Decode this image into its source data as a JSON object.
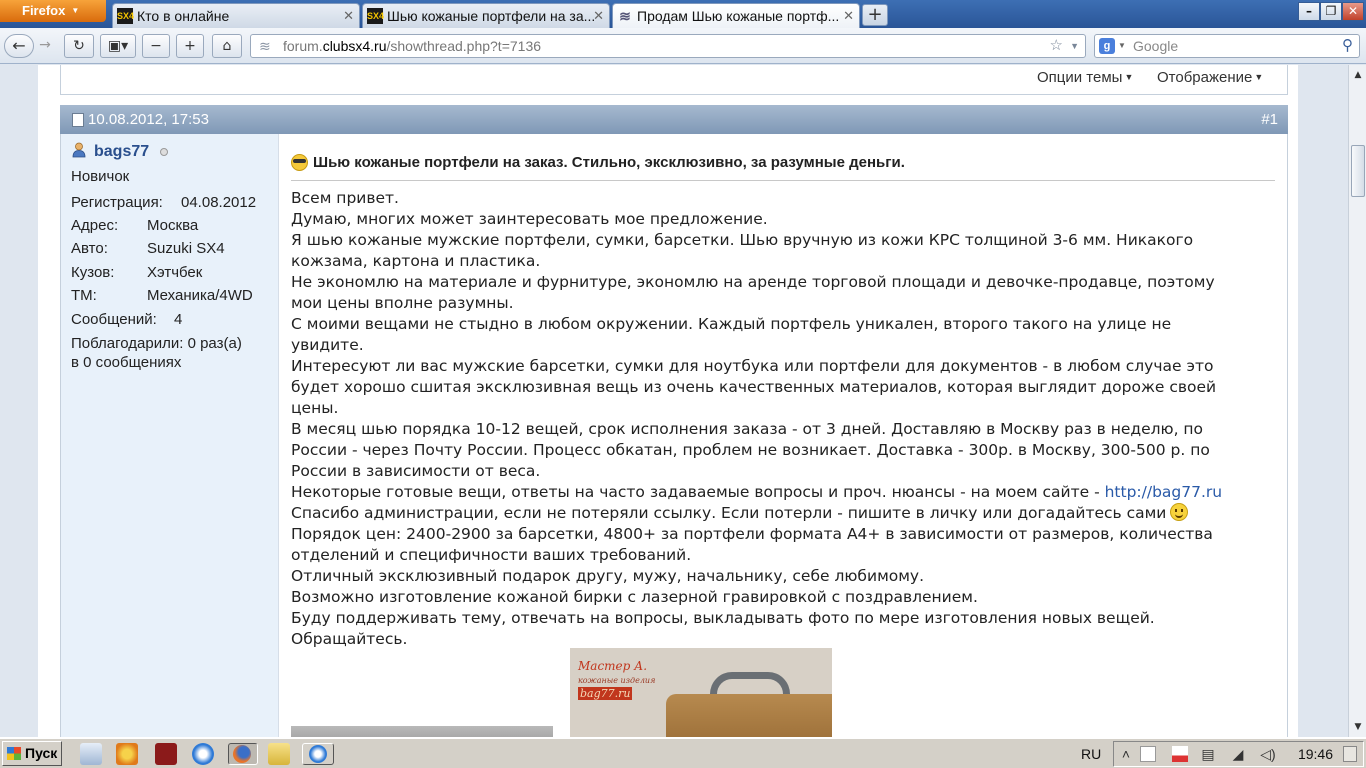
{
  "browser": {
    "menu_button": "Firefox",
    "tabs": [
      {
        "title": "Кто в онлайне",
        "favicon": "SX4"
      },
      {
        "title": "Шью кожаные портфели на за...",
        "favicon": "SX4"
      },
      {
        "title": "Продам Шью кожаные портф...",
        "favicon": "page"
      }
    ],
    "new_tab": "+",
    "window_controls": {
      "minimize": "–",
      "restore": "❐",
      "close": "✕"
    },
    "url": {
      "prefix": "forum.",
      "domain": "clubsx4.ru",
      "path": "/showthread.php?t=7136"
    },
    "search_placeholder": "Google"
  },
  "thread_tools": {
    "options": "Опции темы",
    "display": "Отображение"
  },
  "post": {
    "date": "10.08.2012, 17:53",
    "number": "#1",
    "title": "Шью кожаные портфели на заказ. Стильно, эксклюзивно, за разумные деньги.",
    "author": {
      "username": "bags77",
      "rank": "Новичок",
      "fields": [
        {
          "key": "Регистрация:",
          "value": "04.08.2012"
        },
        {
          "key": "Адрес:",
          "value": "Москва"
        },
        {
          "key": "Авто:",
          "value": "Suzuki SX4"
        },
        {
          "key": "Кузов:",
          "value": "Хэтчбек"
        },
        {
          "key": "ТМ:",
          "value": "Механика/4WD"
        }
      ],
      "posts_label": "Сообщений:",
      "posts_count": "4",
      "thanks_line1": "Поблагодарили: 0 раз(а)",
      "thanks_line2": "в 0 сообщениях"
    },
    "lines": [
      "Всем привет.",
      "Думаю, многих может заинтересовать мое предложение.",
      "Я шью кожаные мужские портфели, сумки, барсетки. Шью вручную из кожи КРС толщиной 3-6 мм. Никакого",
      "кожзама, картона и пластика.",
      "Не экономлю на материале и фурнитуре, экономлю на аренде торговой площади и девочке-продавце, поэтому",
      "мои цены вполне разумны.",
      "С моими вещами не стыдно в любом окружении. Каждый портфель уникален, второго такого на улице не",
      "увидите.",
      "Интересуют ли вас мужские барсетки, сумки для ноутбука или портфели для документов - в любом случае это",
      "будет хорошо сшитая эксклюзивная вещь из очень качественных материалов, которая выглядит дороже своей",
      "цены.",
      "В месяц шью порядка 10-12 вещей, срок исполнения заказа - от 3 дней. Доставляю в Москву раз в неделю, по",
      "России - через Почту России. Процесс обкатан, проблем не возникает. Доставка - 300р. в Москву, 300-500 р. по",
      "России в зависимости от веса."
    ],
    "site_line_prefix": "Некоторые готовые вещи, ответы на часто задаваемые вопросы и проч. нюансы - на моем сайте - ",
    "site_link": "http://bag77.ru",
    "thanks_admin_line": "Спасибо администрации, если не потеряли ссылку. Если потерли - пишите в личку или догадайтесь сами",
    "lines_after": [
      "Порядок цен: 2400-2900 за барсетки, 4800+ за портфели формата А4+ в зависимости от размеров, количества",
      "отделений и специфичности ваших требований.",
      "Отличный эксклюзивный подарок другу, мужу, начальнику, себе любимому.",
      "Возможно изготовление кожаной бирки с лазерной гравировкой с поздравлением.",
      "Буду поддерживать тему, отвечать на вопросы, выкладывать фото по мере изготовления новых вещей.",
      "Обращайтесь."
    ],
    "photo_logo_line1": "Мастер А.",
    "photo_logo_line2": "кожаные изделия",
    "photo_logo_site": "bag77.ru"
  },
  "taskbar": {
    "start": "Пуск",
    "language": "RU",
    "clock": "19:46"
  }
}
